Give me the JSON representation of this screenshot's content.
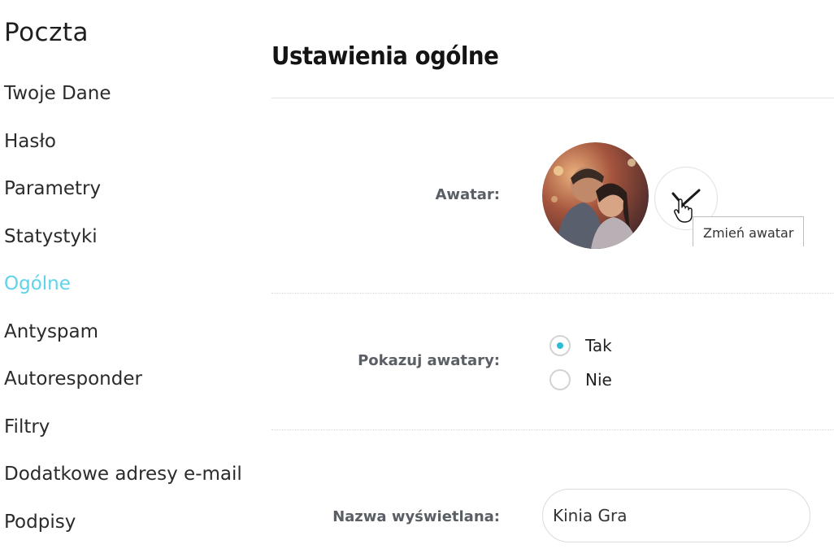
{
  "sidebar": {
    "title": "Poczta",
    "items": [
      {
        "label": "Twoje Dane",
        "active": false
      },
      {
        "label": "Hasło",
        "active": false
      },
      {
        "label": "Parametry",
        "active": false
      },
      {
        "label": "Statystyki",
        "active": false
      },
      {
        "label": "Ogólne",
        "active": true
      },
      {
        "label": "Antyspam",
        "active": false
      },
      {
        "label": "Autoresponder",
        "active": false
      },
      {
        "label": "Filtry",
        "active": false
      },
      {
        "label": "Dodatkowe adresy e-mail",
        "active": false
      },
      {
        "label": "Podpisy",
        "active": false
      }
    ]
  },
  "main": {
    "title": "Ustawienia ogólne",
    "avatar": {
      "label": "Awatar:",
      "tooltip": "Zmień awatar",
      "button_icon": "checkmark-icon"
    },
    "show_avatars": {
      "label": "Pokazuj awatary:",
      "options": [
        {
          "label": "Tak",
          "checked": true
        },
        {
          "label": "Nie",
          "checked": false
        }
      ]
    },
    "display_name": {
      "label": "Nazwa wyświetlana:",
      "value": "Kinia Gra"
    }
  },
  "colors": {
    "accent": "#5fd3e8",
    "radio_dot": "#2bbcd6",
    "label": "#5a5f66"
  }
}
